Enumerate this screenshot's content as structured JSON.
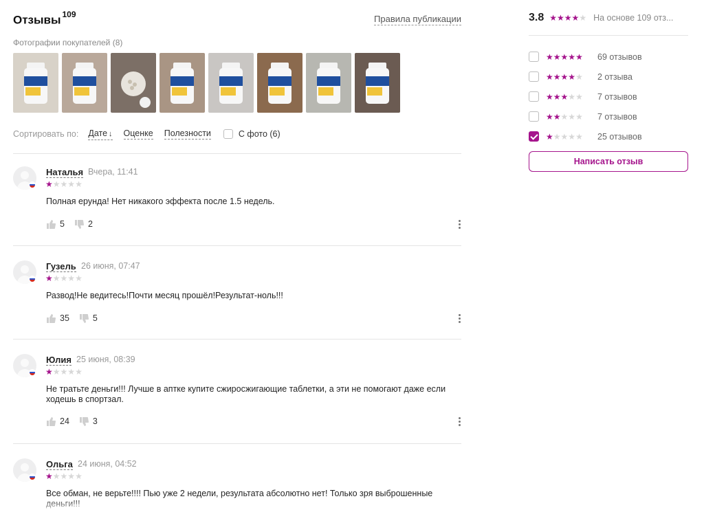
{
  "header": {
    "title": "Отзывы",
    "count": "109",
    "rules_link": "Правила публикации"
  },
  "photos": {
    "label": "Фотографии покупателей (8)",
    "items": [
      {
        "name": "photo-1"
      },
      {
        "name": "photo-2"
      },
      {
        "name": "photo-3"
      },
      {
        "name": "photo-4"
      },
      {
        "name": "photo-5"
      },
      {
        "name": "photo-6"
      },
      {
        "name": "photo-7"
      },
      {
        "name": "photo-8"
      }
    ]
  },
  "sort": {
    "label": "Сортировать по:",
    "options": [
      "Дате",
      "Оценке",
      "Полезности"
    ],
    "active_arrow": "↓",
    "photo_filter": "С фото (6)",
    "photo_filter_checked": false
  },
  "reviews": [
    {
      "name": "Наталья",
      "date": "Вчера, 11:41",
      "rating": 1,
      "text": "Полная ерунда! Нет никакого эффекта после 1.5 недель.",
      "likes": "5",
      "dislikes": "2"
    },
    {
      "name": "Гузель",
      "date": "26 июня, 07:47",
      "rating": 1,
      "text": "Развод!Не ведитесь!Почти месяц прошёл!Результат-ноль!!!",
      "likes": "35",
      "dislikes": "5"
    },
    {
      "name": "Юлия",
      "date": "25 июня, 08:39",
      "rating": 1,
      "text": "Не тратьте деньги!!! Лучше в аптке купите сжиросжигающие таблетки, а эти не помогают даже если ходешь в спортзал.",
      "likes": "24",
      "dislikes": "3"
    },
    {
      "name": "Ольга",
      "date": "24 июня, 04:52",
      "rating": 1,
      "text": "Все обман, не верьте!!!! Пью уже 2 недели, результата абсолютно нет! Только зря выброшенные деньги!!!",
      "likes": "",
      "dislikes": ""
    }
  ],
  "summary": {
    "rating": "3.8",
    "stars": 4,
    "based_on": "На основе 109 отз...",
    "filters": [
      {
        "stars": 5,
        "count": "69 отзывов",
        "checked": false
      },
      {
        "stars": 4,
        "count": "2 отзыва",
        "checked": false
      },
      {
        "stars": 3,
        "count": "7 отзывов",
        "checked": false
      },
      {
        "stars": 2,
        "count": "7 отзывов",
        "checked": false
      },
      {
        "stars": 1,
        "count": "25 отзывов",
        "checked": true
      }
    ],
    "write_button": "Написать отзыв"
  },
  "colors": {
    "accent": "#a5148c",
    "star_off": "#d7d7d7",
    "muted_text": "#999999",
    "divider": "#e4e4e4"
  },
  "icons": [
    "thumbs-up-icon",
    "thumbs-down-icon",
    "more-vertical-icon",
    "sort-down-arrow-icon",
    "star-icon",
    "avatar-placeholder-icon",
    "russia-flag-icon",
    "checkbox-icon"
  ]
}
